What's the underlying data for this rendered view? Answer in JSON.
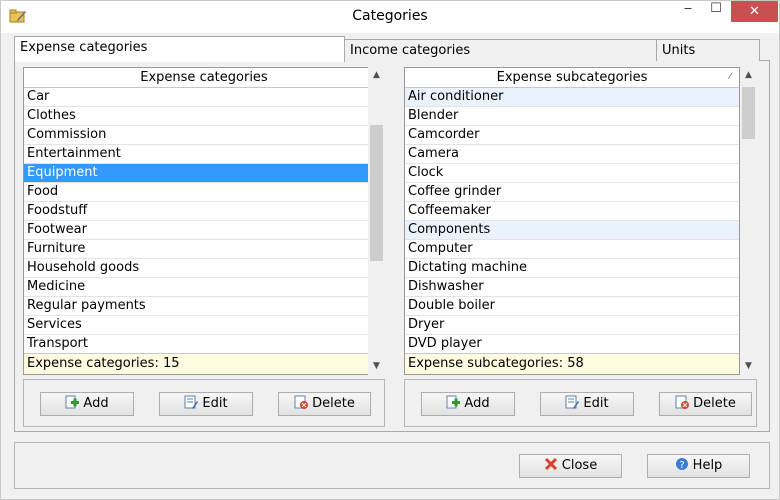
{
  "window": {
    "title": "Categories",
    "close_glyph": "✕",
    "min_glyph": "‒",
    "max_glyph": "☐"
  },
  "tabs": [
    {
      "label": "Expense categories",
      "active": true
    },
    {
      "label": "Income categories",
      "active": false
    },
    {
      "label": "Units",
      "active": false
    }
  ],
  "left": {
    "header": "Expense categories",
    "items": [
      "Car",
      "Clothes",
      "Commission",
      "Entertainment",
      "Equipment",
      "Food",
      "Foodstuff",
      "Footwear",
      "Furniture",
      "Household goods",
      "Medicine",
      "Regular payments",
      "Services",
      "Transport"
    ],
    "selected": "Equipment",
    "footer": "Expense categories: 15",
    "buttons": {
      "add": "Add",
      "edit": "Edit",
      "delete": "Delete"
    }
  },
  "right": {
    "header": "Expense subcategories",
    "items": [
      "Air conditioner",
      "Blender",
      "Camcorder",
      "Camera",
      "Clock",
      "Coffee grinder",
      "Coffeemaker",
      "Components",
      "Computer",
      "Dictating machine",
      "Dishwasher",
      "Double boiler",
      "Dryer",
      "DVD player"
    ],
    "highlighted": [
      "Air conditioner",
      "Components"
    ],
    "footer": "Expense subcategories: 58",
    "buttons": {
      "add": "Add",
      "edit": "Edit",
      "delete": "Delete"
    }
  },
  "footer_buttons": {
    "close": "Close",
    "help": "Help"
  },
  "icons": {
    "app": "folder-pencil-icon",
    "add": "add-document-icon",
    "edit": "edit-document-icon",
    "delete": "delete-document-icon",
    "close": "red-x-icon",
    "help": "help-icon"
  },
  "colors": {
    "selection": "#3399ff",
    "footer_bg": "#fffbe0",
    "close_red": "#c75050"
  }
}
